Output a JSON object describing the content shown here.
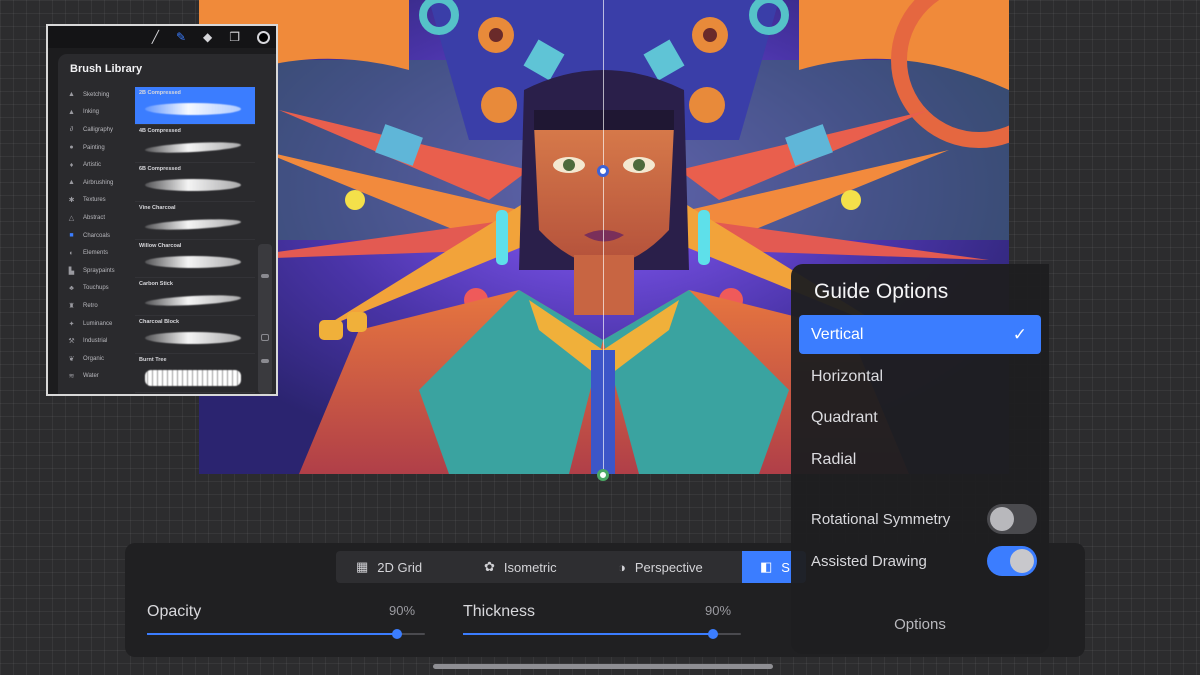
{
  "toolbar": {
    "icons": [
      "brush-icon",
      "smudge-icon",
      "eraser-icon",
      "layers-icon",
      "color-swatch"
    ],
    "active_tool": "smudge-icon",
    "swatch_color": "#000000"
  },
  "brush_library": {
    "title": "Brush Library",
    "add_symbol": "+",
    "categories": [
      {
        "label": "Sketching",
        "icon": "▲"
      },
      {
        "label": "Inking",
        "icon": "▲"
      },
      {
        "label": "Calligraphy",
        "icon": "∂"
      },
      {
        "label": "Painting",
        "icon": "●"
      },
      {
        "label": "Artistic",
        "icon": "♦"
      },
      {
        "label": "Airbrushing",
        "icon": "▲"
      },
      {
        "label": "Textures",
        "icon": "✱"
      },
      {
        "label": "Abstract",
        "icon": "△"
      },
      {
        "label": "Charcoals",
        "icon": "■"
      },
      {
        "label": "Elements",
        "icon": "◐"
      },
      {
        "label": "Spraypaints",
        "icon": "▙"
      },
      {
        "label": "Touchups",
        "icon": "♣"
      },
      {
        "label": "Retro",
        "icon": "♜"
      },
      {
        "label": "Luminance",
        "icon": "✦"
      },
      {
        "label": "Industrial",
        "icon": "⚒"
      },
      {
        "label": "Organic",
        "icon": "❦"
      },
      {
        "label": "Water",
        "icon": "≋"
      }
    ],
    "active_category": "Charcoals",
    "brushes": [
      "2B Compressed",
      "4B Compressed",
      "6B Compressed",
      "Vine Charcoal",
      "Willow Charcoal",
      "Carbon Stick",
      "Charcoal Block",
      "Burnt Tree"
    ],
    "selected_brush": "2B Compressed"
  },
  "guide_panel": {
    "tabs": [
      {
        "label": "2D Grid",
        "icon": "▦"
      },
      {
        "label": "Isometric",
        "icon": "✿"
      },
      {
        "label": "Perspective",
        "icon": "◑"
      },
      {
        "label": "S",
        "icon": "◧"
      }
    ],
    "active_tab": "S",
    "opacity": {
      "label": "Opacity",
      "value_text": "90%",
      "fraction": 0.9
    },
    "thickness": {
      "label": "Thickness",
      "value_text": "90%",
      "fraction": 0.9
    }
  },
  "guide_options": {
    "title": "Guide Options",
    "options": [
      "Vertical",
      "Horizontal",
      "Quadrant",
      "Radial"
    ],
    "selected": "Vertical",
    "checkmark": "✓",
    "toggles": [
      {
        "label": "Rotational Symmetry",
        "on": false
      },
      {
        "label": "Assisted Drawing",
        "on": true
      }
    ],
    "footer_button": "Options"
  },
  "accent_color": "#3b7dff"
}
